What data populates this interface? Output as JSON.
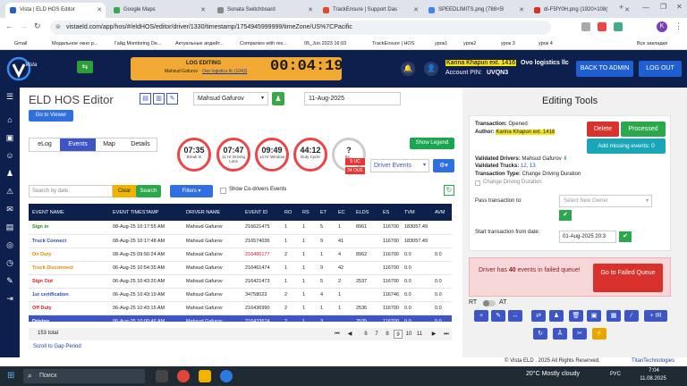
{
  "browser": {
    "tabs": [
      {
        "label": "Vista | ELD HOS Editor",
        "active": true,
        "color": "#1f5fd1"
      },
      {
        "label": "Google Maps",
        "active": false,
        "color": "#34a853"
      },
      {
        "label": "Sonata Switchboard",
        "active": false,
        "color": "#888888"
      },
      {
        "label": "TrackEnsure | Support Das",
        "active": false,
        "color": "#e24a2c"
      },
      {
        "label": "SPEEDLIMITS.png (788×5!",
        "active": false,
        "color": "#4285f4"
      },
      {
        "label": "di-F5fY0H.png (1920×108(",
        "active": false,
        "color": "#d93025"
      }
    ],
    "url": "vistaeld.com/app/hos/#/eldHOS/editor/driver/1330/timestamp/1754945999999/timeZone/US%7CPacific",
    "bookmarks": [
      "Gmail",
      "Модальное окно р...",
      "Гайд Monitoring De...",
      "Актуальные апдейт...",
      "Companies with res...",
      "05_Jun.2023 16:03",
      "TrackEnsure | HOS",
      "урок1",
      "урок2",
      "урок 3",
      "урок 4",
      "Все закладки"
    ]
  },
  "header": {
    "logo_text": "Vista",
    "log_editing_label": "LOG EDITING",
    "log_editing_sub": "Mahsud Gafurov",
    "log_editing_link": "Ovo logistics llc (1043)",
    "timer": "00:04:19",
    "user_name": "Karina Khapun ext. 1416",
    "company": "Ovo logistics llc",
    "account_pin_label": "Account PIN:",
    "account_pin": "UVQN3",
    "back_to_admin": "BACK TO ADMIN",
    "logout": "LOG OUT"
  },
  "editor": {
    "title": "ELD HOS Editor",
    "go_to_viewer": "Go to Viewer",
    "driver_select": "Mahsud Gafurov",
    "date": "11-Aug-2025",
    "tabs": [
      "eLog",
      "Events",
      "Map",
      "Details"
    ],
    "active_tab": "Events",
    "show_legend": "Show Legend",
    "driver_events": "Driver Events",
    "search_placeholder": "Search by date",
    "clear": "Clear",
    "search": "Search",
    "filters": "Filters",
    "show_codrivers": "Show Co-drivers Events",
    "total": "153 total",
    "scroll_to_gap": "Scroll to Gap Period",
    "pages": [
      "6",
      "7",
      "8",
      "9",
      "10",
      "11"
    ],
    "current_page": "9",
    "badge_uc": "5 UC",
    "badge_oue": "34 OUE"
  },
  "circles": [
    {
      "value": "07:35",
      "label": "Break In"
    },
    {
      "value": "07:47",
      "label": "11 Hr Driving Limit"
    },
    {
      "value": "09:49",
      "label": "14 Hr Window"
    },
    {
      "value": "44:12",
      "label": "Duty Cycle"
    },
    {
      "value": "?",
      "label": "Se..."
    }
  ],
  "table": {
    "columns": [
      "EVENT NAME",
      "EVENT TIMESTAMP",
      "DRIVER NAME",
      "EVENT ID",
      "RO",
      "RS",
      "ET",
      "EC",
      "ELDS",
      "ES",
      "TVM",
      "AVM"
    ],
    "rows": [
      {
        "name": "Sign in",
        "color": "#2a8a2a",
        "ts": "08-Aug-25 10:17:55 AM",
        "driver": "Mahsud Gafurov",
        "id": "216621475",
        "ro": "1",
        "rs": "1",
        "et": "5",
        "ec": "1",
        "elds": "8961",
        "es": "116700",
        "tvm": "183057.49",
        "avm": ""
      },
      {
        "name": "Truck Connect",
        "color": "#2a50b8",
        "ts": "08-Aug-25 10:17:48 AM",
        "driver": "Mahsud Gafurov",
        "id": "216574036",
        "ro": "1",
        "rs": "1",
        "et": "9",
        "ec": "41",
        "elds": "",
        "es": "116700",
        "tvm": "183057.49",
        "avm": ""
      },
      {
        "name": "On Duty",
        "color": "#e08a00",
        "ts": "08-Aug-25 09:56:24 AM",
        "driver": "Mahsud Gafurov",
        "id": "216486177",
        "ro": "2",
        "rs": "1",
        "et": "1",
        "ec": "4",
        "elds": "8962",
        "es": "116700",
        "tvm": "0.0",
        "avm": "0.0"
      },
      {
        "name": "Truck Disconnect",
        "color": "#e08a00",
        "ts": "06-Aug-25 10:54:35 AM",
        "driver": "Mahsud Gafurov",
        "id": "216461474",
        "ro": "1",
        "rs": "1",
        "et": "9",
        "ec": "42",
        "elds": "",
        "es": "116700",
        "tvm": "0.0",
        "avm": ""
      },
      {
        "name": "Sign Out",
        "color": "#d0202a",
        "ts": "06-Aug-25 10:43:20 AM",
        "driver": "Mahsud Gafurov",
        "id": "216421473",
        "ro": "1",
        "rs": "1",
        "et": "5",
        "ec": "2",
        "elds": "2537",
        "es": "116700",
        "tvm": "0.0",
        "avm": "0.0"
      },
      {
        "name": "1st certification",
        "color": "#2a50b8",
        "ts": "06-Aug-25 10:43:19 AM",
        "driver": "Mahsud Gafurov",
        "id": "34758023",
        "ro": "2",
        "rs": "1",
        "et": "4",
        "ec": "1",
        "elds": "",
        "es": "116746",
        "tvm": "0.0",
        "avm": "0.0"
      },
      {
        "name": "Off Duty",
        "color": "#d0202a",
        "ts": "06-Aug-25 10:43:15 AM",
        "driver": "Mahsud Gafurov",
        "id": "216436990",
        "ro": "2",
        "rs": "1",
        "et": "1",
        "ec": "1",
        "elds": "2536",
        "es": "116700",
        "tvm": "0.0",
        "avm": "0.0"
      },
      {
        "name": "Driving",
        "color": "#ffffff",
        "ts": "06-Aug-25 10:00:46 AM",
        "driver": "Mahsud Gafurov",
        "id": "216433674",
        "ro": "2",
        "rs": "1",
        "et": "3",
        "ec": "",
        "elds": "2535",
        "es": "116700",
        "tvm": "0.0",
        "avm": "0.0"
      }
    ]
  },
  "tools": {
    "title": "Editing Tools",
    "transaction_label": "Transaction:",
    "transaction_status": "Opened",
    "author_label": "Author:",
    "author": "Karina Khapun ext. 1416",
    "delete": "Delete",
    "processed": "Processed",
    "add_missing": "Add missing events: 0",
    "validated_drivers_label": "Validated Drivers:",
    "validated_drivers": "Mahsud Gafurov",
    "validated_trucks_label": "Validated Trucks:",
    "validated_trucks": "12, 13",
    "transaction_type_label": "Transaction Type:",
    "transaction_type": "Change Driving Duration",
    "change_driving_duration": "Change Driving Duration",
    "pass_transaction": "Pass transaction to:",
    "select_owner": "Select New Owner",
    "start_transaction": "Start transaction from date:",
    "start_date": "01-Aug-2025 20:3",
    "failed_text_pre": "Driver has",
    "failed_count": "40",
    "failed_text_post": "events in failed queue!",
    "go_failed": "Go to Failed Queue",
    "rt": "RT",
    "at": "AT",
    "ir": "+ IR"
  },
  "footer": {
    "copyright": "© Vista ELD . 2025 All Rights Reserved.",
    "powered": "TitanTechnologies"
  },
  "taskbar": {
    "search": "Поиск",
    "weather": "20°C  Mostly cloudy",
    "lang": "РУС",
    "time": "7:04",
    "date": "11.08.2025"
  }
}
